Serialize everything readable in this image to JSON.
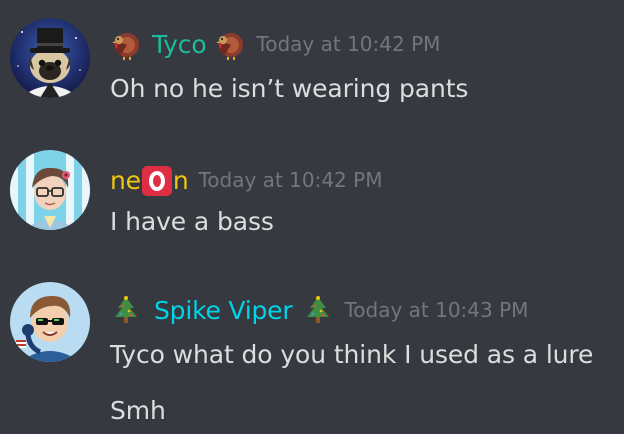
{
  "colors": {
    "background": "#36393f",
    "message_text": "#dcddde",
    "timestamp": "#72767d",
    "tyco_name": "#1abc9c",
    "neon_name": "#f1c40f",
    "spike_name": "#00d4e8"
  },
  "messages": [
    {
      "author": "Tyco",
      "author_decoration_left_icon": "turkey-icon",
      "author_decoration_right_icon": "turkey-icon",
      "timestamp": "Today at 10:42 PM",
      "avatar_icon": "pug-top-hat-avatar",
      "lines": [
        "Oh no he isn’t wearing pants"
      ]
    },
    {
      "author_prefix": "ne",
      "author_badge_icon": "o-button-icon",
      "author_suffix": "n",
      "timestamp": "Today at 10:42 PM",
      "avatar_icon": "anime-glasses-avatar",
      "lines": [
        "I have a bass"
      ]
    },
    {
      "author": "Spike Viper",
      "author_decoration_left_icon": "christmas-tree-icon",
      "author_decoration_right_icon": "christmas-tree-icon",
      "timestamp": "Today at 10:43 PM",
      "avatar_icon": "cartoon-headphones-avatar",
      "lines": [
        "Tyco what do you think I used as a lure",
        "Smh"
      ]
    }
  ]
}
